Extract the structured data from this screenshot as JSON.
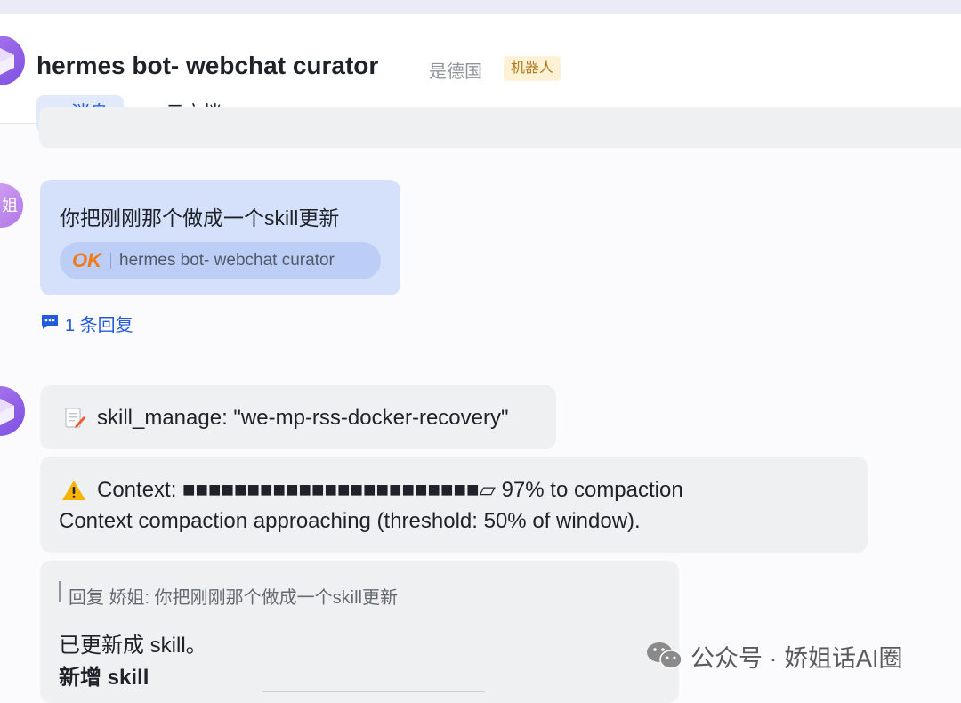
{
  "header": {
    "title": "hermes bot- webchat curator",
    "org": "是德国",
    "badge": "机器人",
    "tabs": [
      {
        "label": "消息",
        "icon": "chat-bubble-icon",
        "active": true
      },
      {
        "label": "云文档",
        "icon": "cloud-doc-icon",
        "active": false
      }
    ],
    "add_tab_label": "+"
  },
  "messages": {
    "user_message": {
      "avatar_text": "姐",
      "text": "你把刚刚那个做成一个skill更新",
      "ref_reaction": "OK",
      "ref_name": "hermes bot- webchat curator"
    },
    "reply_count_label": "1 条回复",
    "tool_call": {
      "icon": "memo-pencil-icon",
      "text": "skill_manage: \"we-mp-rss-docker-recovery\""
    },
    "context_warning": {
      "icon": "warning-icon",
      "line1": "Context: ■■■■■■■■■■■■■■■■■■■■■■■▱ 97% to compaction",
      "line2": "Context compaction approaching (threshold: 50% of window)."
    },
    "reply": {
      "quote": "回复 娇姐: 你把刚刚那个做成一个skill更新",
      "line1": "已更新成 skill。",
      "line2": "新增 skill"
    }
  },
  "watermark": {
    "icon": "wechat-icon",
    "text": "公众号 · 娇姐话AI圈"
  },
  "colors": {
    "accent": "#245bdb",
    "user_bubble": "#d5e1fb",
    "bot_bubble": "#eff0f1",
    "badge_bg": "#fdf1d6",
    "badge_text": "#b07a1a"
  }
}
